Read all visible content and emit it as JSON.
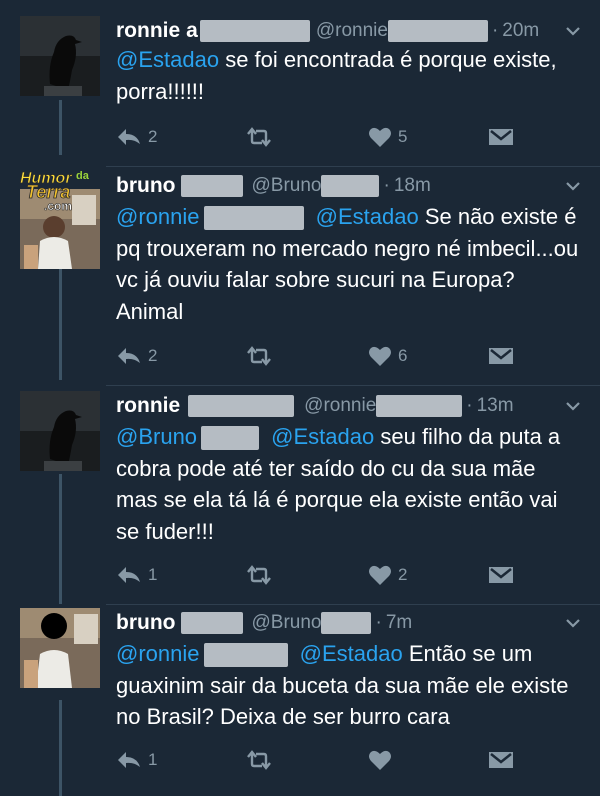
{
  "tweets": [
    {
      "display_name": "ronnie",
      "display_name_suffix": "a",
      "handle": "@ronnie",
      "time": "20m",
      "mentions": [
        "@Estadao"
      ],
      "text": "se foi encontrada é porque existe, porra!!!!!!",
      "replies": "2",
      "retweets": "",
      "likes": "5"
    },
    {
      "display_name": "bruno",
      "handle": "@Bruno",
      "time": "18m",
      "mentions": [
        "@ronnie",
        "@Estadao"
      ],
      "text": "Se não existe é pq trouxeram no mercado negro né imbecil...ou vc já ouviu falar sobre sucuri na Europa? Animal",
      "replies": "2",
      "retweets": "",
      "likes": "6"
    },
    {
      "display_name": "ronnie",
      "handle": "@ronnie",
      "time": "13m",
      "mentions": [
        "@Bruno",
        "@Estadao"
      ],
      "text": "seu filho da puta a cobra pode até ter saído do cu da sua mãe mas se ela tá lá é porque ela existe então vai se fuder!!!",
      "replies": "1",
      "retweets": "",
      "likes": "2"
    },
    {
      "display_name": "bruno",
      "handle": "@Bruno",
      "time": "7m",
      "mentions": [
        "@ronnie",
        "@Estadao"
      ],
      "text": "Então se um guaxinim sair da buceta da sua mãe ele existe no Brasil? Deixa de ser burro cara",
      "replies": "1",
      "retweets": "",
      "likes": ""
    }
  ],
  "watermark": {
    "line1": "Humor",
    "line1_small": "da",
    "line2": "Terra",
    "line3": ".com"
  },
  "colors": {
    "background": "#1b2836",
    "mention": "#2aa3ef",
    "meta": "#8899a6",
    "redaction": "#b5bcc3"
  },
  "icons": [
    "reply-icon",
    "retweet-icon",
    "like-icon",
    "direct-message-icon",
    "chevron-down-icon"
  ]
}
